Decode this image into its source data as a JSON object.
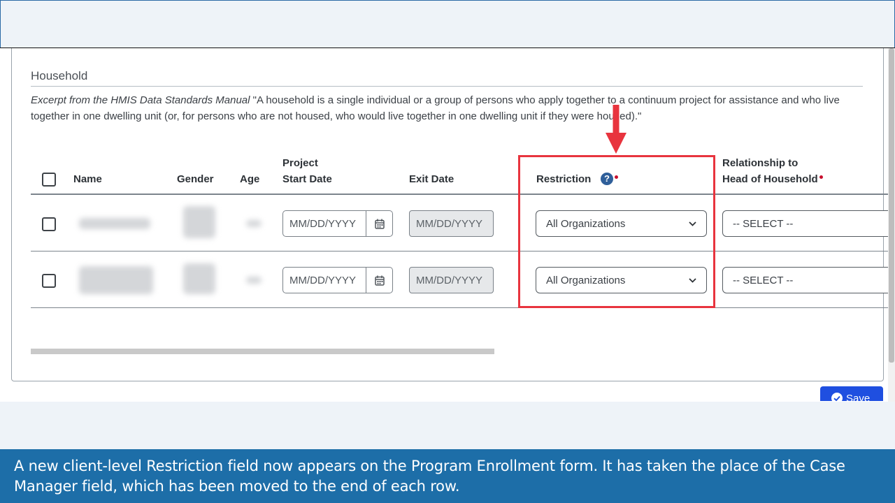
{
  "section": {
    "title": "Household",
    "excerpt_label": "Excerpt from the HMIS Data Standards Manual",
    "excerpt_text": " \"A household is a single individual or a group of persons who apply together to a continuum project for assistance and who live together in one dwelling unit (or, for persons who are not housed, who would live together in one dwelling unit if they were housed).\""
  },
  "table": {
    "headers": {
      "name": "Name",
      "gender": "Gender",
      "age": "Age",
      "project_start_line1": "Project",
      "project_start_line2": "Start Date",
      "exit_date": "Exit Date",
      "restriction": "Restriction",
      "relationship_line1": "Relationship to",
      "relationship_line2": "Head of Household"
    },
    "rows": [
      {
        "start_placeholder": "MM/DD/YYYY",
        "exit_placeholder": "MM/DD/YYYY",
        "restriction": "All Organizations",
        "relationship": "-- SELECT --"
      },
      {
        "start_placeholder": "MM/DD/YYYY",
        "exit_placeholder": "MM/DD/YYYY",
        "restriction": "All Organizations",
        "relationship": "-- SELECT --"
      }
    ]
  },
  "help_icon": "question-circle-icon",
  "calendar_icon": "calendar-icon",
  "save_button": {
    "label": "Save",
    "icon": "check-circle-icon"
  },
  "caption": "A new client-level Restriction field now appears on the Program Enrollment form. It has taken the place of the Case Manager field, which has been moved to the end of each row.",
  "colors": {
    "highlight": "#e8343e",
    "caption_bg": "#1d6ea8",
    "save_button": "#1f4fe0",
    "help_icon": "#2f5f9a",
    "required": "#c8102e"
  }
}
